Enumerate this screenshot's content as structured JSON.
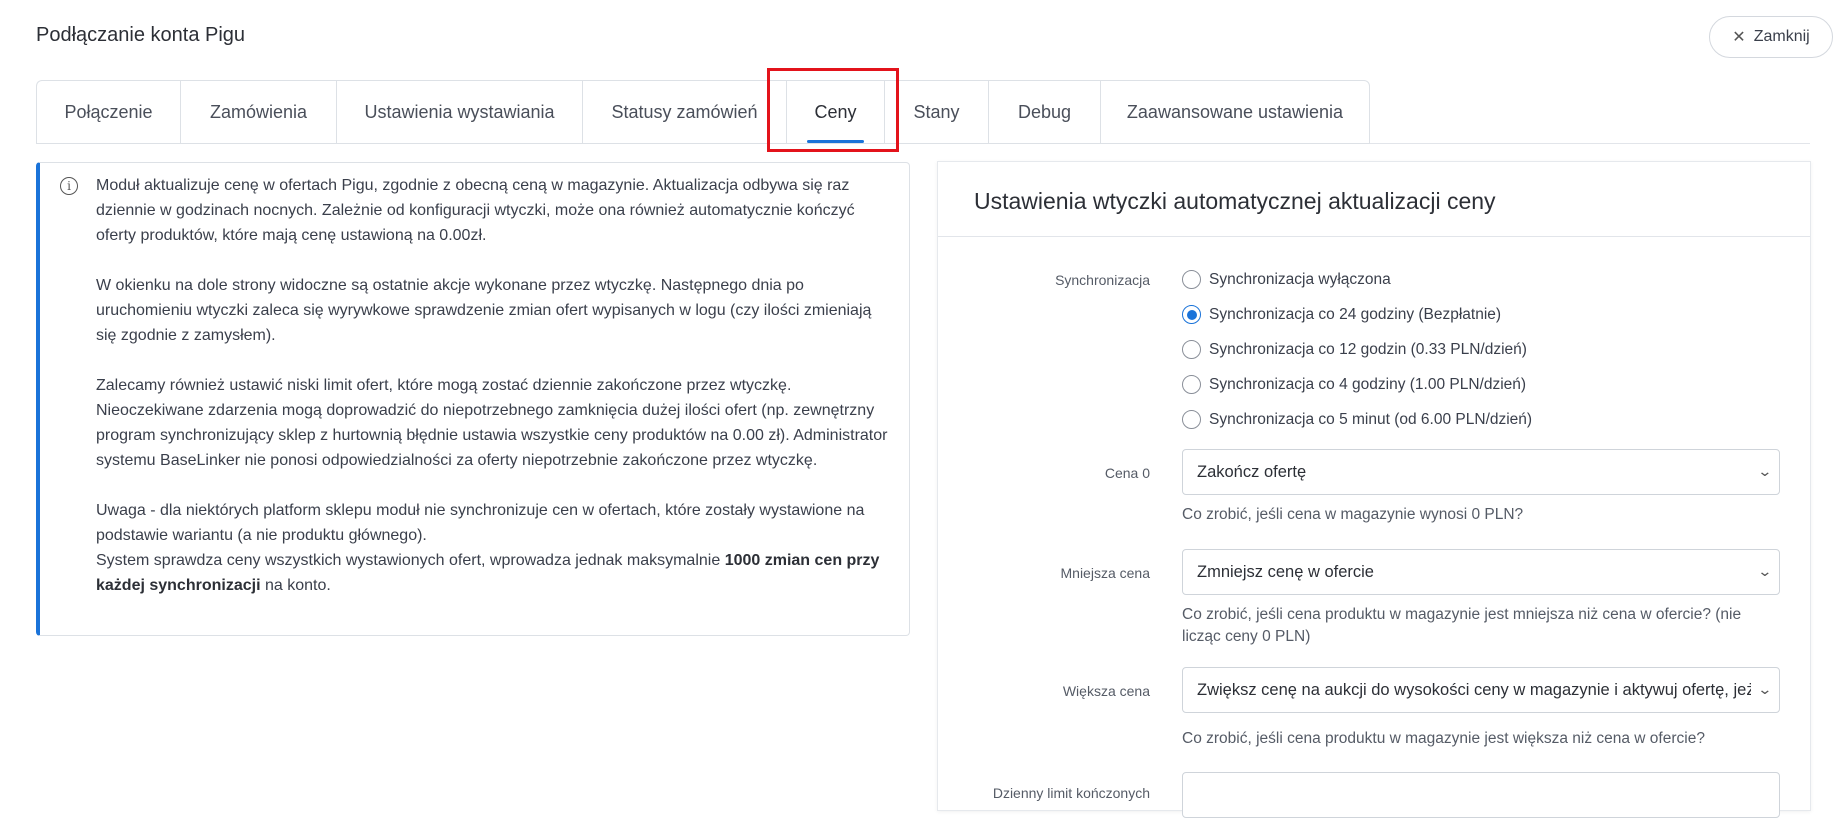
{
  "header": {
    "title": "Podłączanie konta Pigu",
    "close_label": "Zamknij"
  },
  "tabs": [
    {
      "label": "Połączenie"
    },
    {
      "label": "Zamówienia"
    },
    {
      "label": "Ustawienia wystawiania"
    },
    {
      "label": "Statusy zamówień"
    },
    {
      "label": "Ceny"
    },
    {
      "label": "Stany"
    },
    {
      "label": "Debug"
    },
    {
      "label": "Zaawansowane ustawienia"
    }
  ],
  "active_tab": "Ceny",
  "info": {
    "p1": "Moduł aktualizuje cenę w ofertach Pigu, zgodnie z obecną ceną w magazynie. Aktualizacja odbywa się raz dziennie w godzinach nocnych. Zależnie od konfiguracji wtyczki, może ona również automatycznie kończyć oferty produktów, które mają cenę ustawioną na 0.00zł.",
    "p2": "W okienku na dole strony widoczne są ostatnie akcje wykonane przez wtyczkę. Następnego dnia po uruchomieniu wtyczki zaleca się wyrywkowe sprawdzenie zmian ofert wypisanych w logu (czy ilości zmieniają się zgodnie z zamysłem).",
    "p3": "Zalecamy również ustawić niski limit ofert, które mogą zostać dziennie zakończone przez wtyczkę. Nieoczekiwane zdarzenia mogą doprowadzić do niepotrzebnego zamknięcia dużej ilości ofert (np. zewnętrzny program synchronizujący sklep z hurtownią błędnie ustawia wszystkie ceny produktów na 0.00 zł). Administrator systemu BaseLinker nie ponosi odpowiedzialności za oferty niepotrzebnie zakończone przez wtyczkę.",
    "p4a": "Uwaga - dla niektórych platform sklepu moduł nie synchronizuje cen w ofertach, które zostały wystawione na podstawie wariantu (a nie produktu głównego).",
    "p4b_pre": "System sprawdza ceny wszystkich wystawionych ofert, wprowadza jednak maksymalnie ",
    "p4b_bold": "1000 zmian cen przy każdej synchronizacji",
    "p4b_post": " na konto."
  },
  "settings": {
    "title": "Ustawienia wtyczki automatycznej aktualizacji ceny",
    "sync_label": "Synchronizacja",
    "sync_options": [
      {
        "label": "Synchronizacja wyłączona",
        "checked": false
      },
      {
        "label": "Synchronizacja co 24 godziny (Bezpłatnie)",
        "checked": true
      },
      {
        "label": "Synchronizacja co 12 godzin (0.33 PLN/dzień)",
        "checked": false
      },
      {
        "label": "Synchronizacja co 4 godziny (1.00 PLN/dzień)",
        "checked": false
      },
      {
        "label": "Synchronizacja co 5 minut (od 6.00 PLN/dzień)",
        "checked": false
      }
    ],
    "price0": {
      "label": "Cena 0",
      "value": "Zakończ ofertę",
      "help": "Co zrobić, jeśli cena w magazynie wynosi 0 PLN?"
    },
    "lower": {
      "label": "Mniejsza cena",
      "value": "Zmniejsz cenę w ofercie",
      "help": "Co zrobić, jeśli cena produktu w magazynie jest mniejsza niż cena w ofercie? (nie licząc ceny 0 PLN)"
    },
    "higher": {
      "label": "Większa cena",
      "value": "Zwiększ cenę na aukcji do wysokości ceny w magazynie i aktywuj ofertę, jeżeli",
      "help": "Co zrobić, jeśli cena produktu w magazynie jest większa niż cena w ofercie?"
    },
    "daily_limit": {
      "label": "Dzienny limit kończonych"
    }
  },
  "colors": {
    "accent": "#1a73d9",
    "highlight": "#e3131b"
  }
}
